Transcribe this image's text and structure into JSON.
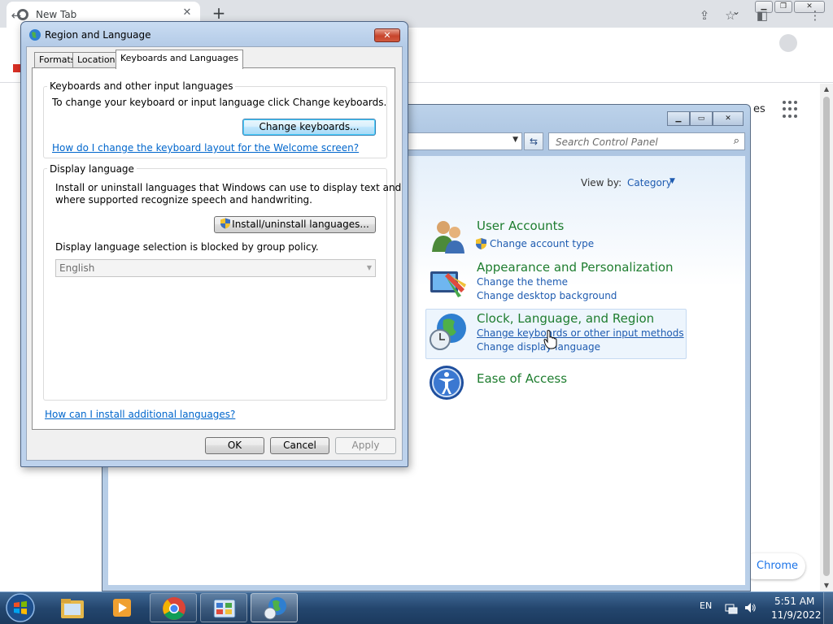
{
  "browser": {
    "tab_title": "New Tab",
    "tab_close": "✕",
    "new_tab": "+",
    "images_link": "es",
    "customize_chrome": "Chrome"
  },
  "control_panel": {
    "search_placeholder": "Search Control Panel",
    "view_by_label": "View by:",
    "view_by_value": "Category",
    "categories": [
      {
        "title": "User Accounts",
        "links": [
          "Change account type"
        ]
      },
      {
        "title": "Appearance and Personalization",
        "links": [
          "Change the theme",
          "Change desktop background"
        ]
      },
      {
        "title": "Clock, Language, and Region",
        "links": [
          "Change keyboards or other input methods",
          "Change display language"
        ]
      },
      {
        "title": "Ease of Access",
        "links": []
      }
    ]
  },
  "dialog": {
    "title": "Region and Language",
    "close": "✕",
    "tabs": [
      "Formats",
      "Location",
      "Keyboards and Languages"
    ],
    "active_tab": "Keyboards and Languages",
    "keyboards_group": {
      "label": "Keyboards and other input languages",
      "description": "To change your keyboard or input language click Change keyboards.",
      "button": "Change keyboards...",
      "help_link": "How do I change the keyboard layout for the Welcome screen?"
    },
    "display_group": {
      "label": "Display language",
      "description_line1": "Install or uninstall languages that Windows can use to display text and",
      "description_line2": "where supported recognize speech and handwriting.",
      "button": "Install/uninstall languages...",
      "blocked_text": "Display language selection is blocked by group policy.",
      "selected_language": "English"
    },
    "bottom_link": "How can I install additional languages?",
    "ok": "OK",
    "cancel": "Cancel",
    "apply": "Apply"
  },
  "taskbar": {
    "language": "EN",
    "time": "5:51 AM",
    "date": "11/9/2022"
  }
}
